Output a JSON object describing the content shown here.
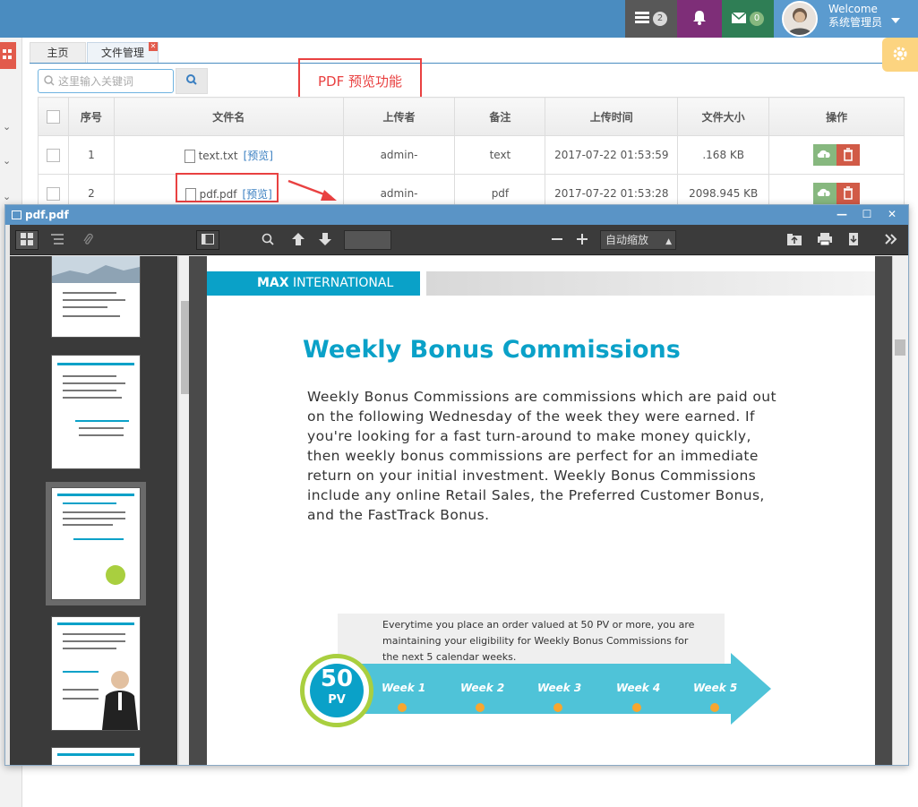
{
  "topbar": {
    "tasks_count": "2",
    "mail_count": "0",
    "welcome": "Welcome",
    "username": "系统管理员"
  },
  "tabs": [
    {
      "label": "主页"
    },
    {
      "label": "文件管理"
    }
  ],
  "search": {
    "placeholder": "这里输入关键词"
  },
  "annotation": "PDF 预览功能",
  "table": {
    "headers": [
      "序号",
      "文件名",
      "上传者",
      "备注",
      "上传时间",
      "文件大小",
      "操作"
    ],
    "rows": [
      {
        "no": "1",
        "filename": "text.txt",
        "preview": "[预览]",
        "uploader": "admin-",
        "note": "text",
        "time": "2017-07-22 01:53:59",
        "size": ".168 KB"
      },
      {
        "no": "2",
        "filename": "pdf.pdf",
        "preview": "[预览]",
        "uploader": "admin-",
        "note": "pdf",
        "time": "2017-07-22 01:53:28",
        "size": "2098.945 KB"
      }
    ]
  },
  "modal": {
    "title": "pdf.pdf",
    "zoom": "自动缩放"
  },
  "pdf": {
    "brand_bold": "MAX",
    "brand_rest": " INTERNATIONAL",
    "title": "Weekly Bonus Commissions",
    "body": "Weekly Bonus Commissions are commissions which are paid out on the following Wednesday of the week they were earned. If you're looking for a fast turn-around to make money quickly, then weekly bonus commissions are perfect for an immediate return on your initial investment. Weekly Bonus Commissions include any online Retail Sales, the Preferred Customer Bonus, and the FastTrack Bonus.",
    "note": "Everytime you place an order valued at 50 PV or more, you are maintaining your eligibility for Weekly Bonus Commissions for the next 5 calendar weeks.",
    "badge_num": "50",
    "badge_unit": "PV",
    "weeks": [
      "Week 1",
      "Week 2",
      "Week 3",
      "Week 4",
      "Week 5"
    ]
  },
  "colors": {
    "accent": "#0aa1c8",
    "topbar": "#4a8cc0",
    "annotation": "#e94141"
  }
}
